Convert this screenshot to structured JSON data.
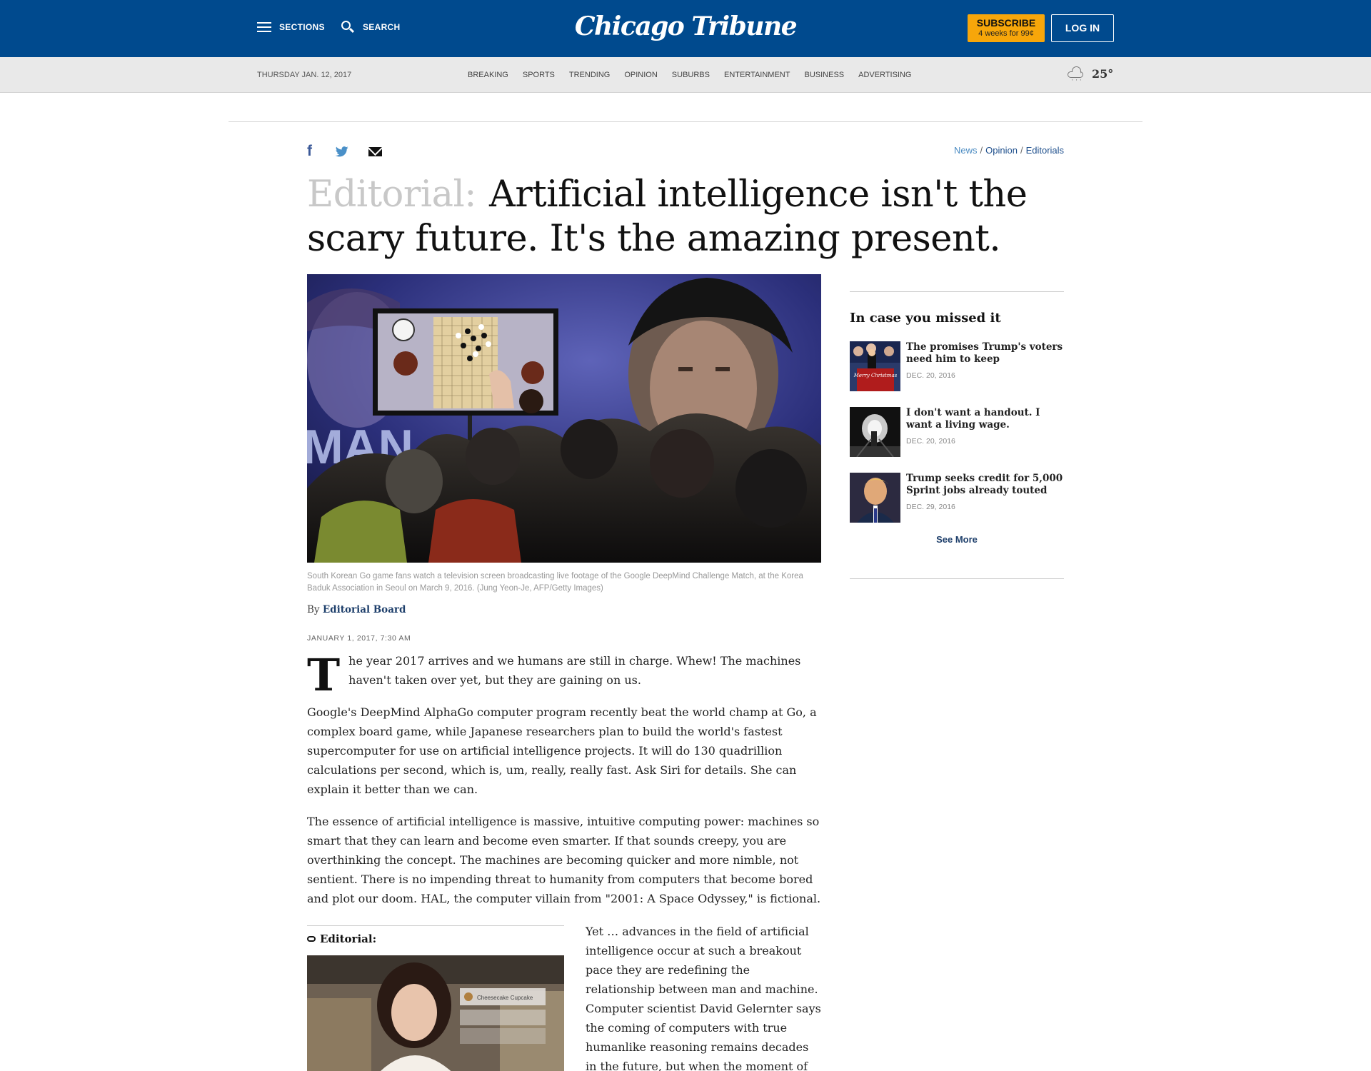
{
  "header": {
    "sections_label": "SECTIONS",
    "search_label": "SEARCH",
    "logo_text": "Chicago Tribune",
    "subscribe_label": "SUBSCRIBE",
    "subscribe_offer": "4 weeks for 99¢",
    "login_label": "LOG IN",
    "colors": {
      "background": "#004a8e",
      "subscribe": "#f7a60a"
    }
  },
  "navbar": {
    "date": "THURSDAY JAN. 12, 2017",
    "links": [
      "BREAKING",
      "SPORTS",
      "TRENDING",
      "OPINION",
      "SUBURBS",
      "ENTERTAINMENT",
      "BUSINESS",
      "ADVERTISING"
    ],
    "weather_icon": "cloud-rain-icon",
    "temperature": "25°"
  },
  "share": {
    "icons": [
      "facebook-icon",
      "twitter-icon",
      "email-icon"
    ]
  },
  "breadcrumb": [
    "News",
    "Opinion",
    "Editorials"
  ],
  "article": {
    "label": "Editorial:",
    "headline": "Artificial intelligence isn't the scary future. It's the amazing present.",
    "image_caption": "South Korean Go game fans watch a television screen broadcasting live footage of the Google DeepMind Challenge Match, at the Korea Baduk Association in Seoul on March 9, 2016. (Jung Yeon-Je, AFP/Getty Images)",
    "image_overlay_text": "MAN",
    "byline_prefix": "By",
    "author": "Editorial Board",
    "date": "JANUARY 1, 2017, 7:30 AM",
    "dropcap": "T",
    "paragraphs": [
      "he year 2017 arrives and we humans are still in charge. Whew! The machines haven't taken over yet, but they are gaining on us.",
      "Google's DeepMind AlphaGo computer program recently beat the world champ at Go, a complex board game, while Japanese researchers plan to build the world's fastest supercomputer for use on artificial intelligence projects. It will do 130 quadrillion calculations per second, which is, um, really, really fast. Ask Siri for details. She can explain it better than we can.",
      "The essence of artificial intelligence is massive, intuitive computing power: machines so smart that they can learn and become even smarter. If that sounds creepy, you are overthinking the concept. The machines are becoming quicker and more nimble, not sentient. There is no impending threat to humanity from computers that become bored and plot our doom. HAL, the computer villain from \"2001: A Space Odyssey,\" is fictional."
    ],
    "column_text": "Yet … advances in the field of artificial intelligence occur at such a breakout pace they are redefining the relationship between man and machine. Computer scientist David Gelernter says the coming of computers with true humanlike reasoning remains decades in the future, but when the moment of \"artificial"
  },
  "related": {
    "label": "Editorial:",
    "image_items": [
      "Cheesecake Cupcake"
    ]
  },
  "sidebar": {
    "heading": "In case you missed it",
    "items": [
      {
        "title": "The promises Trump's voters need him to keep",
        "date": "DEC. 20, 2016",
        "thumb_text": "Merry Christmas"
      },
      {
        "title": "I don't want a handout. I want a living wage.",
        "date": "DEC. 20, 2016"
      },
      {
        "title": "Trump seeks credit for 5,000 Sprint jobs already touted",
        "date": "DEC. 29, 2016"
      }
    ],
    "see_more": "See More"
  }
}
